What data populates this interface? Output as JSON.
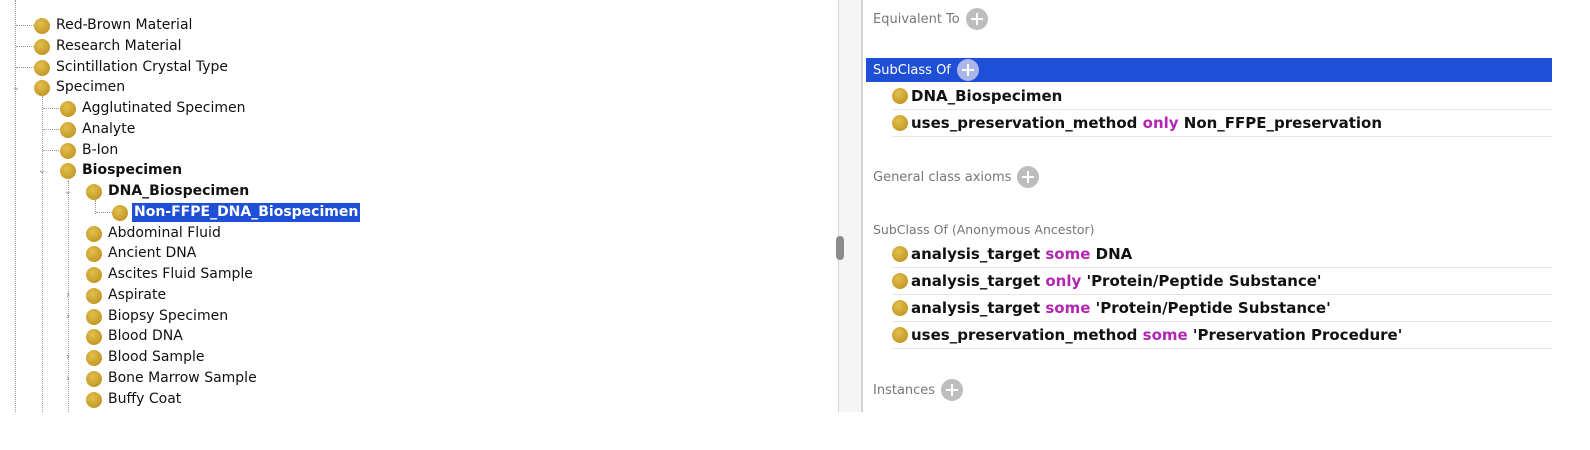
{
  "class_tree": {
    "items": [
      {
        "label": "Red-Brown Material",
        "bold": false,
        "selected": false
      },
      {
        "label": "Research Material",
        "bold": false,
        "selected": false
      },
      {
        "label": "Scintillation Crystal Type",
        "bold": false,
        "selected": false
      },
      {
        "label": "Specimen",
        "bold": false,
        "selected": false,
        "expanded": true
      },
      {
        "label": "Agglutinated Specimen",
        "bold": false,
        "selected": false
      },
      {
        "label": "Analyte",
        "bold": false,
        "selected": false
      },
      {
        "label": "B-Ion",
        "bold": false,
        "selected": false
      },
      {
        "label": "Biospecimen",
        "bold": true,
        "selected": false,
        "expanded": true
      },
      {
        "label": "DNA_Biospecimen",
        "bold": true,
        "selected": false,
        "expanded": true
      },
      {
        "label": "Non-FFPE_DNA_Biospecimen",
        "bold": true,
        "selected": true
      },
      {
        "label": "Abdominal Fluid",
        "bold": false,
        "selected": false
      },
      {
        "label": "Ancient DNA",
        "bold": false,
        "selected": false
      },
      {
        "label": "Ascites Fluid Sample",
        "bold": false,
        "selected": false
      },
      {
        "label": "Aspirate",
        "bold": false,
        "selected": false,
        "collapsed": true
      },
      {
        "label": "Biopsy Specimen",
        "bold": false,
        "selected": false,
        "collapsed": true
      },
      {
        "label": "Blood DNA",
        "bold": false,
        "selected": false
      },
      {
        "label": "Blood Sample",
        "bold": false,
        "selected": false,
        "collapsed": true
      },
      {
        "label": "Bone Marrow Sample",
        "bold": false,
        "selected": false,
        "collapsed": true
      },
      {
        "label": "Buffy Coat",
        "bold": false,
        "selected": false
      }
    ]
  },
  "description": {
    "equivalent_to": {
      "title": "Equivalent To"
    },
    "subclass_of": {
      "title": "SubClass Of",
      "axioms": [
        [
          {
            "t": "DNA_Biospecimen",
            "kw": false
          }
        ],
        [
          {
            "t": "uses_preservation_method ",
            "kw": false
          },
          {
            "t": "only",
            "kw": true
          },
          {
            "t": " Non_FFPE_preservation",
            "kw": false
          }
        ]
      ]
    },
    "general_class_axioms": {
      "title": "General class axioms"
    },
    "anonymous_ancestor": {
      "title": "SubClass Of (Anonymous Ancestor)",
      "axioms": [
        [
          {
            "t": "analysis_target ",
            "kw": false
          },
          {
            "t": "some",
            "kw": true
          },
          {
            "t": " DNA",
            "kw": false
          }
        ],
        [
          {
            "t": "analysis_target ",
            "kw": false
          },
          {
            "t": "only",
            "kw": true
          },
          {
            "t": " 'Protein/Peptide Substance'",
            "kw": false
          }
        ],
        [
          {
            "t": "analysis_target ",
            "kw": false
          },
          {
            "t": "some",
            "kw": true
          },
          {
            "t": " 'Protein/Peptide Substance'",
            "kw": false
          }
        ],
        [
          {
            "t": "uses_preservation_method ",
            "kw": false
          },
          {
            "t": "some",
            "kw": true
          },
          {
            "t": " 'Preservation Procedure'",
            "kw": false
          }
        ]
      ]
    },
    "instances": {
      "title": "Instances"
    }
  },
  "colors": {
    "selection": "#1f4fd6",
    "keyword": "#b326b3",
    "class_bullet": "#c89d2a"
  }
}
